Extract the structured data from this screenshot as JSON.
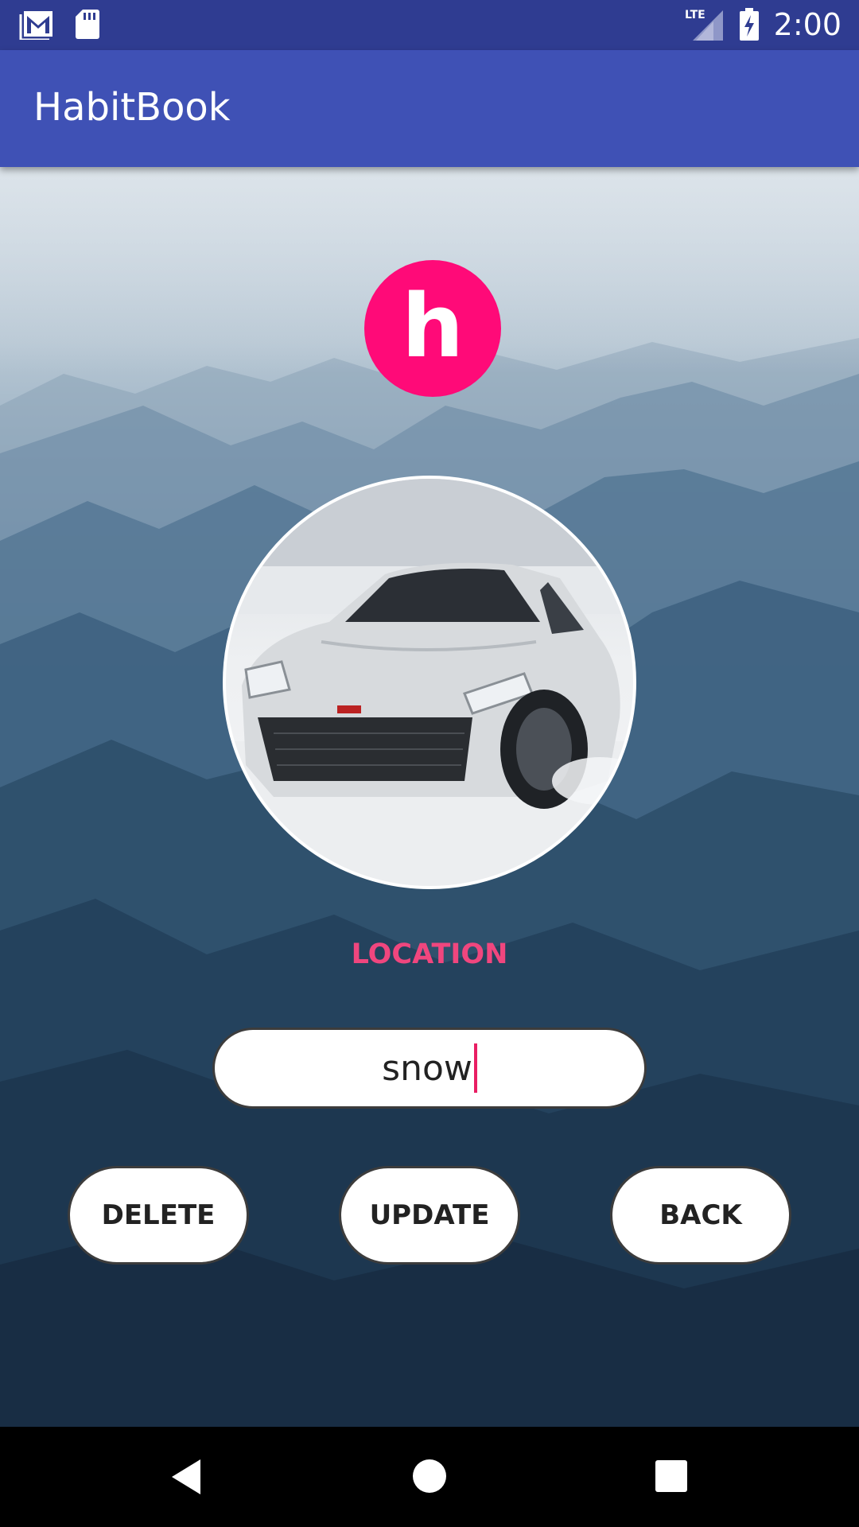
{
  "status_bar": {
    "time": "2:00",
    "network": "LTE"
  },
  "app_bar": {
    "title": "HabitBook"
  },
  "logo": {
    "letter": "h",
    "color": "#ff0a78"
  },
  "detail": {
    "label": "LOCATION",
    "label_color": "#f0467e",
    "location_value": "snow"
  },
  "actions": {
    "delete": "DELETE",
    "update": "UPDATE",
    "back": "BACK"
  },
  "icons": {
    "gmail": "gmail-icon",
    "sd_card": "sd-card-icon",
    "signal": "signal-icon",
    "battery": "battery-charging-icon",
    "nav_back": "nav-back-icon",
    "nav_home": "nav-home-icon",
    "nav_recents": "nav-recents-icon"
  },
  "colors": {
    "status_bar": "#2f3c91",
    "app_bar": "#3f51b5",
    "cursor": "#e91e63"
  }
}
